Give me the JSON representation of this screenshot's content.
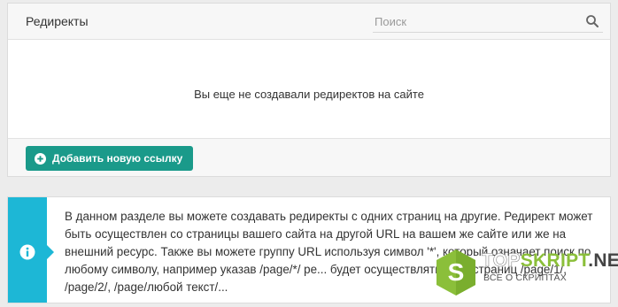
{
  "panel": {
    "title": "Редиректы",
    "search": {
      "placeholder": "Поиск",
      "value": ""
    },
    "empty_message": "Вы еще не создавали редиректов на сайте",
    "add_button_label": "Добавить новую ссылку"
  },
  "info": {
    "text": "В данном разделе вы можете создавать редиректы с одних страниц на другие. Редирект может быть осуществлен со страницы вашего сайта на другой URL на вашем же сайте или же на внешний ресурс. Также вы можете группу URL используя символ '*', который означает поиск по любому символу, например указав /page/*/ ре... будет осуществляться со страниц /page/1/, /page/2/, /page/любой текст/..."
  },
  "watermark": {
    "title_part1": "TOP",
    "title_part2": "SKRIPT",
    "title_part3": ".NET",
    "subtitle": "ВСЕ О СКРИПТАХ"
  },
  "colors": {
    "accent_button": "#1a9a8a",
    "info_strip": "#1db7d6",
    "watermark_green": "#8bbf3a"
  }
}
